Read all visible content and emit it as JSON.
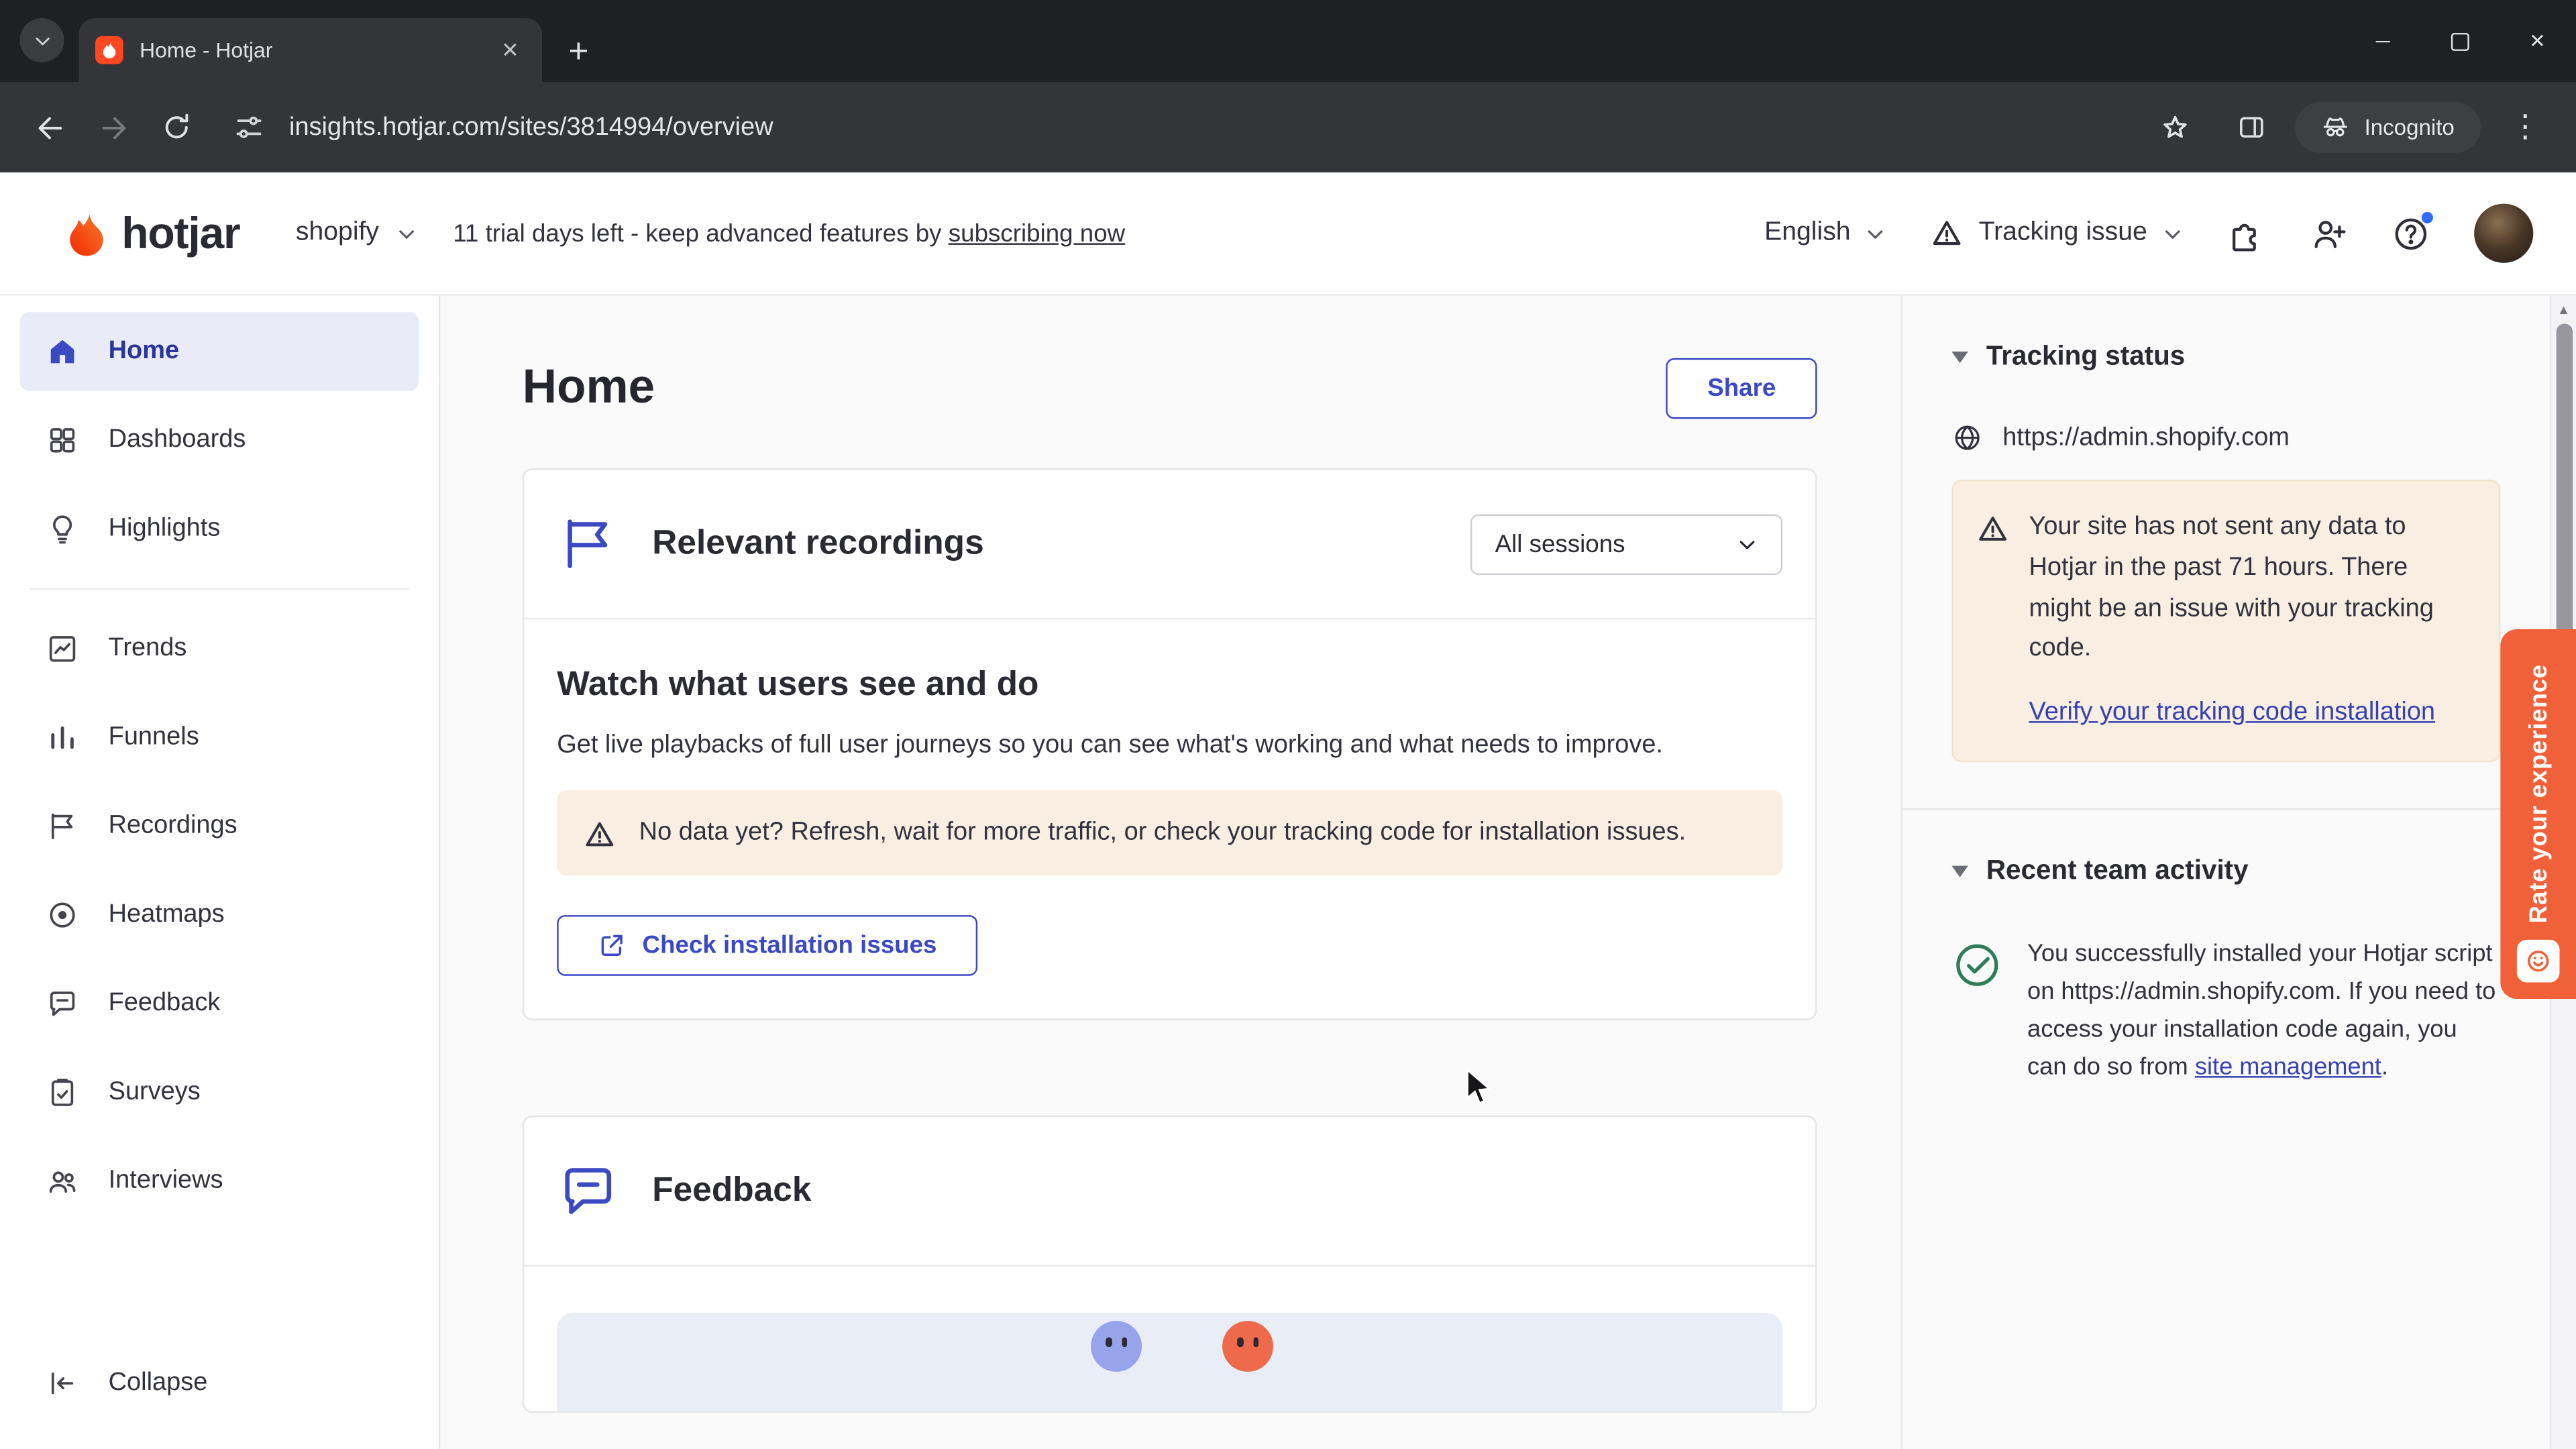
{
  "browser": {
    "tab_title": "Home - Hotjar",
    "url": "insights.hotjar.com/sites/3814994/overview",
    "incognito_label": "Incognito"
  },
  "header": {
    "logo_text": "hotjar",
    "site_name": "shopify",
    "trial_text": "11 trial days left - keep advanced features by",
    "trial_link_label": "subscribing now",
    "language_label": "English",
    "tracking_issue_label": "Tracking issue"
  },
  "sidebar": {
    "items": [
      {
        "label": "Home"
      },
      {
        "label": "Dashboards"
      },
      {
        "label": "Highlights"
      },
      {
        "label": "Trends"
      },
      {
        "label": "Funnels"
      },
      {
        "label": "Recordings"
      },
      {
        "label": "Heatmaps"
      },
      {
        "label": "Feedback"
      },
      {
        "label": "Surveys"
      },
      {
        "label": "Interviews"
      }
    ],
    "collapse_label": "Collapse"
  },
  "main": {
    "page_title": "Home",
    "share_label": "Share",
    "recordings": {
      "card_title": "Relevant recordings",
      "filter_value": "All sessions",
      "heading": "Watch what users see and do",
      "description": "Get live playbacks of full user journeys so you can see what's working and what needs to improve.",
      "warning_text": "No data yet? Refresh, wait for more traffic, or check your tracking code for installation issues.",
      "cta_label": "Check installation issues"
    },
    "feedback": {
      "card_title": "Feedback"
    }
  },
  "right_panel": {
    "tracking_status_title": "Tracking status",
    "site_url": "https://admin.shopify.com",
    "warning_text": "Your site has not sent any data to Hotjar in the past 71 hours. There might be an issue with your tracking code.",
    "warning_link_label": "Verify your tracking code installation",
    "team_activity_title": "Recent team activity",
    "activity_text": "You successfully installed your Hotjar script on https://admin.shopify.com. If you need to access your installation code again, you can do so from",
    "activity_link_label": "site management",
    "activity_suffix": "."
  },
  "rate_tab_label": "Rate your experience",
  "icons": {
    "plus": "+",
    "menu": "⋮",
    "close": "✕",
    "minimize": "─",
    "scroll_up": "▲"
  },
  "colors": {
    "brand_orange": "#ff4722",
    "primary_blue": "#3b49c3",
    "warning_bg": "#f8efe2",
    "rate_tab_orange": "#f0613a",
    "active_nav_bg": "#e9ecf6"
  }
}
